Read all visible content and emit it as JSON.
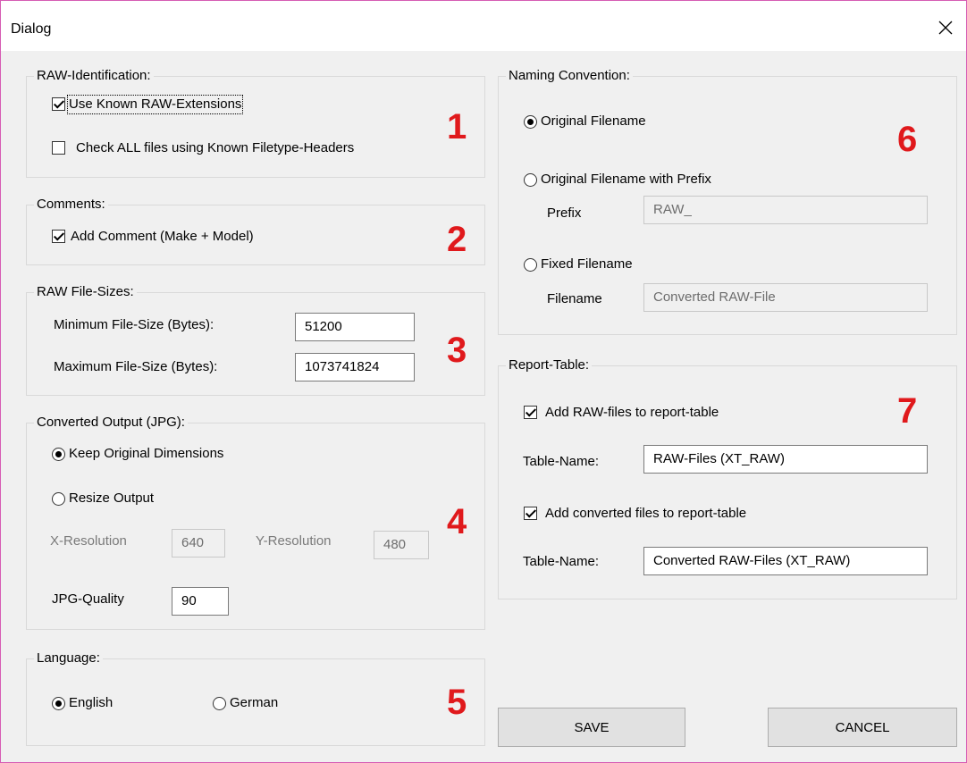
{
  "window": {
    "title": "Dialog",
    "close_icon": "close-icon"
  },
  "raw_identification": {
    "legend": "RAW-Identification:",
    "use_known_extensions": {
      "label": "Use Known RAW-Extensions",
      "checked": true
    },
    "check_all_headers": {
      "label": "Check ALL files using Known Filetype-Headers",
      "checked": false
    },
    "marker": "1"
  },
  "comments": {
    "legend": "Comments:",
    "add_comment": {
      "label": "Add Comment (Make + Model)",
      "checked": true
    },
    "marker": "2"
  },
  "file_sizes": {
    "legend": "RAW File-Sizes:",
    "min_label": "Minimum File-Size (Bytes):",
    "min_value": "51200",
    "max_label": "Maximum File-Size (Bytes):",
    "max_value": "1073741824",
    "marker": "3"
  },
  "converted_output": {
    "legend": "Converted Output (JPG):",
    "keep_original": {
      "label": "Keep Original Dimensions",
      "selected": true
    },
    "resize_output": {
      "label": "Resize Output",
      "selected": false
    },
    "x_res_label": "X-Resolution",
    "x_res_value": "640",
    "y_res_label": "Y-Resolution",
    "y_res_value": "480",
    "quality_label": "JPG-Quality",
    "quality_value": "90",
    "marker": "4"
  },
  "language": {
    "legend": "Language:",
    "english": {
      "label": "English",
      "selected": true
    },
    "german": {
      "label": "German",
      "selected": false
    },
    "marker": "5"
  },
  "naming": {
    "legend": "Naming Convention:",
    "original": {
      "label": "Original Filename",
      "selected": true
    },
    "with_prefix": {
      "label": "Original Filename with Prefix",
      "selected": false
    },
    "prefix_label": "Prefix",
    "prefix_value": "RAW_",
    "fixed": {
      "label": "Fixed Filename",
      "selected": false
    },
    "filename_label": "Filename",
    "filename_value": "Converted RAW-File",
    "marker": "6"
  },
  "report_table": {
    "legend": "Report-Table:",
    "add_raw": {
      "label": "Add RAW-files to report-table",
      "checked": true
    },
    "table_name_label": "Table-Name:",
    "raw_table_name": "RAW-Files (XT_RAW)",
    "add_converted": {
      "label": "Add converted files to report-table",
      "checked": true
    },
    "converted_table_name": "Converted RAW-Files (XT_RAW)",
    "marker": "7"
  },
  "buttons": {
    "save": "SAVE",
    "cancel": "CANCEL"
  },
  "colors": {
    "marker_red": "#e0191c",
    "window_border": "#d65cb4",
    "background": "#f0f0f0"
  }
}
